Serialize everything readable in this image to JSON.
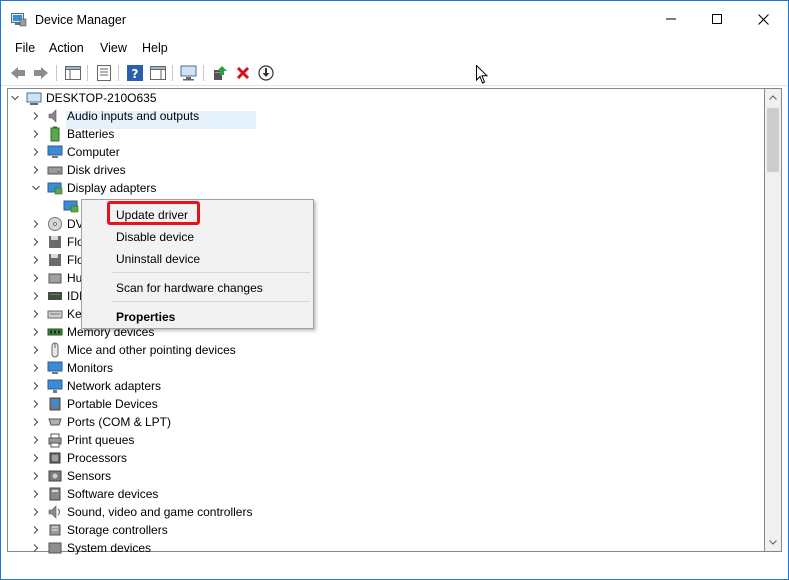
{
  "window": {
    "title": "Device Manager",
    "controls": {
      "minimize": "minimize",
      "maximize": "maximize",
      "close": "close"
    }
  },
  "menu": [
    "File",
    "Action",
    "View",
    "Help"
  ],
  "toolbar": {
    "icons": [
      "back-arrow-icon",
      "forward-arrow-icon",
      "show-hide-console-tree-icon",
      "properties-icon",
      "help-icon",
      "action-pane-icon",
      "scan-hardware-icon",
      "update-driver-icon",
      "uninstall-icon",
      "download-driver-icon"
    ]
  },
  "tree": {
    "root": "DESKTOP-210O635",
    "items": [
      {
        "label": "Audio inputs and outputs",
        "icon": "speaker-icon",
        "state": "collapsed"
      },
      {
        "label": "Batteries",
        "icon": "battery-icon",
        "state": "collapsed"
      },
      {
        "label": "Computer",
        "icon": "computer-icon",
        "state": "collapsed"
      },
      {
        "label": "Disk drives",
        "icon": "disk-drive-icon",
        "state": "collapsed"
      },
      {
        "label": "Display adapters",
        "icon": "display-adapter-icon",
        "state": "expanded"
      },
      {
        "label": "",
        "icon": "display-adapter-child-icon",
        "state": "child"
      },
      {
        "label": "DV",
        "icon": "dvd-icon",
        "state": "collapsed"
      },
      {
        "label": "Flo",
        "icon": "floppy-icon",
        "state": "collapsed"
      },
      {
        "label": "Flo",
        "icon": "floppy-controller-icon",
        "state": "collapsed"
      },
      {
        "label": "Hu",
        "icon": "hid-icon",
        "state": "collapsed"
      },
      {
        "label": "IDI",
        "icon": "ide-icon",
        "state": "collapsed"
      },
      {
        "label": "Ke",
        "icon": "keyboard-icon",
        "state": "collapsed"
      },
      {
        "label": "Memory devices",
        "icon": "memory-icon",
        "state": "collapsed"
      },
      {
        "label": "Mice and other pointing devices",
        "icon": "mouse-icon",
        "state": "collapsed"
      },
      {
        "label": "Monitors",
        "icon": "monitor-icon",
        "state": "collapsed"
      },
      {
        "label": "Network adapters",
        "icon": "network-icon",
        "state": "collapsed"
      },
      {
        "label": "Portable Devices",
        "icon": "portable-device-icon",
        "state": "collapsed"
      },
      {
        "label": "Ports (COM & LPT)",
        "icon": "port-icon",
        "state": "collapsed"
      },
      {
        "label": "Print queues",
        "icon": "printer-icon",
        "state": "collapsed"
      },
      {
        "label": "Processors",
        "icon": "processor-icon",
        "state": "collapsed"
      },
      {
        "label": "Sensors",
        "icon": "sensor-icon",
        "state": "collapsed"
      },
      {
        "label": "Software devices",
        "icon": "software-device-icon",
        "state": "collapsed"
      },
      {
        "label": "Sound, video and game controllers",
        "icon": "sound-icon",
        "state": "collapsed"
      },
      {
        "label": "Storage controllers",
        "icon": "storage-icon",
        "state": "collapsed"
      },
      {
        "label": "System devices",
        "icon": "system-icon",
        "state": "collapsed"
      }
    ]
  },
  "context_menu": {
    "update": "Update driver",
    "disable": "Disable device",
    "uninstall": "Uninstall device",
    "scan": "Scan for hardware changes",
    "properties": "Properties"
  },
  "colors": {
    "window_border": "#1e77d3",
    "highlight_border": "#e8101a",
    "selection": "#e5f1fb",
    "menu_bg": "#f2f2f2"
  }
}
